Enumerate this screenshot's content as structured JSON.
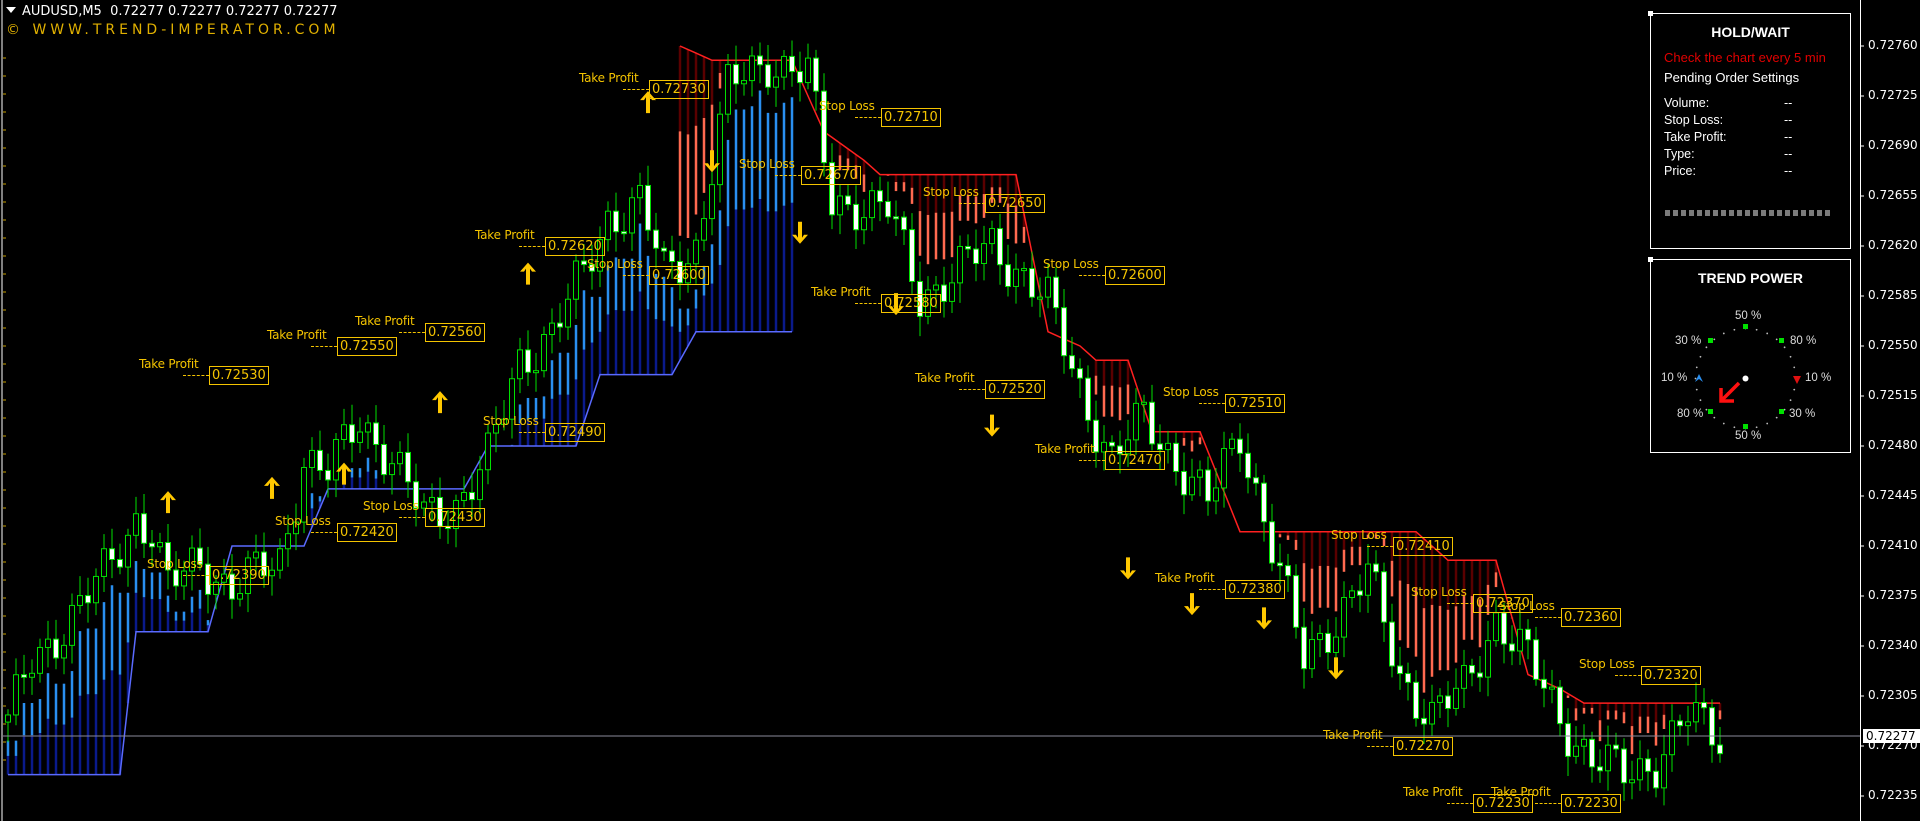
{
  "header": {
    "symbol": "AUDUSD,M5",
    "ohlc": "0.72277 0.72277 0.72277 0.72277",
    "brand": "© WWW.TREND-IMPERATOR.COM"
  },
  "colors": {
    "bull_candle": "#00e000",
    "candle_fill": "#ffffff",
    "up_band_light": "#2a8ff0",
    "up_band_dark": "#0a1a8a",
    "up_stop_line": "#5a6aff",
    "down_band_light": "#ff6a50",
    "down_band_dark": "#5a0000",
    "down_stop_line": "#ff2020",
    "label": "#f4c400",
    "arrow": "#ffc800",
    "price_line": "#8a8a9a"
  },
  "hold_panel": {
    "title": "HOLD/WAIT",
    "warning": "Check the chart every 5 min",
    "subtitle": "Pending Order Settings",
    "rows": [
      {
        "label": "Volume:",
        "value": "--"
      },
      {
        "label": "Stop Loss:",
        "value": "--"
      },
      {
        "label": "Take Profit:",
        "value": "--"
      },
      {
        "label": "Type:",
        "value": "--"
      },
      {
        "label": "Price:",
        "value": "--"
      }
    ]
  },
  "trend_power": {
    "title": "TREND POWER",
    "labels": {
      "top": "50 %",
      "top_left": "30 %",
      "top_right": "80 %",
      "left": "10 %",
      "right": "10 %",
      "bottom_left": "80 %",
      "bottom_right": "30 %",
      "bottom": "50 %"
    },
    "direction": "down-left"
  },
  "chart_data": {
    "type": "candlestick",
    "title": "AUDUSD,M5",
    "xlabel": "",
    "ylabel": "",
    "ylim": [
      0.72216,
      0.72783
    ],
    "y_ticks": [
      "0.72760",
      "0.72725",
      "0.72690",
      "0.72655",
      "0.72620",
      "0.72585",
      "0.72550",
      "0.72515",
      "0.72480",
      "0.72445",
      "0.72410",
      "0.72375",
      "0.72340",
      "0.72305",
      "0.72270",
      "0.72235"
    ],
    "current_price": "0.72277",
    "candle_count": 215,
    "close_waypoints": [
      [
        0,
        0.72285
      ],
      [
        3,
        0.7233
      ],
      [
        8,
        0.7236
      ],
      [
        12,
        0.7239
      ],
      [
        16,
        0.7243
      ],
      [
        18,
        0.7242
      ],
      [
        20,
        0.7238
      ],
      [
        24,
        0.724
      ],
      [
        28,
        0.7238
      ],
      [
        34,
        0.724
      ],
      [
        37,
        0.7247
      ],
      [
        40,
        0.7246
      ],
      [
        44,
        0.725
      ],
      [
        48,
        0.7247
      ],
      [
        52,
        0.7243
      ],
      [
        56,
        0.7244
      ],
      [
        60,
        0.7247
      ],
      [
        64,
        0.7254
      ],
      [
        68,
        0.7256
      ],
      [
        72,
        0.726
      ],
      [
        75,
        0.7264
      ],
      [
        79,
        0.7265
      ],
      [
        82,
        0.726
      ],
      [
        86,
        0.7262
      ],
      [
        90,
        0.7273
      ],
      [
        95,
        0.7275
      ],
      [
        100,
        0.7274
      ],
      [
        103,
        0.7265
      ],
      [
        106,
        0.7265
      ],
      [
        110,
        0.72645
      ],
      [
        114,
        0.72585
      ],
      [
        118,
        0.726
      ],
      [
        123,
        0.7262
      ],
      [
        127,
        0.726
      ],
      [
        130,
        0.7258
      ],
      [
        134,
        0.7252
      ],
      [
        138,
        0.7247
      ],
      [
        142,
        0.725
      ],
      [
        146,
        0.7247
      ],
      [
        150,
        0.7244
      ],
      [
        154,
        0.7249
      ],
      [
        158,
        0.7241
      ],
      [
        162,
        0.7233
      ],
      [
        166,
        0.7236
      ],
      [
        170,
        0.7239
      ],
      [
        174,
        0.7232
      ],
      [
        178,
        0.7229
      ],
      [
        182,
        0.7231
      ],
      [
        186,
        0.7236
      ],
      [
        190,
        0.7233
      ],
      [
        194,
        0.7229
      ],
      [
        198,
        0.7226
      ],
      [
        202,
        0.7225
      ],
      [
        206,
        0.7226
      ],
      [
        210,
        0.7229
      ],
      [
        214,
        0.72277
      ]
    ],
    "up_trend": {
      "range": [
        0,
        98
      ],
      "stop_steps": [
        [
          0,
          0.7225
        ],
        [
          14,
          0.7225
        ],
        [
          16,
          0.7235
        ],
        [
          25,
          0.7235
        ],
        [
          28,
          0.7241
        ],
        [
          37,
          0.7241
        ],
        [
          40,
          0.7245
        ],
        [
          57,
          0.7245
        ],
        [
          60,
          0.7248
        ],
        [
          71,
          0.7248
        ],
        [
          74,
          0.7253
        ],
        [
          83,
          0.7253
        ],
        [
          86,
          0.7256
        ],
        [
          98,
          0.7256
        ]
      ]
    },
    "down_trend": {
      "range": [
        84,
        214
      ],
      "stop_steps": [
        [
          84,
          0.7276
        ],
        [
          88,
          0.7275
        ],
        [
          98,
          0.7275
        ],
        [
          102,
          0.727
        ],
        [
          107,
          0.7268
        ],
        [
          109,
          0.7267
        ],
        [
          126,
          0.7267
        ],
        [
          130,
          0.7256
        ],
        [
          134,
          0.7255
        ],
        [
          136,
          0.7254
        ],
        [
          140,
          0.7254
        ],
        [
          143,
          0.7249
        ],
        [
          149,
          0.7249
        ],
        [
          154,
          0.7242
        ],
        [
          176,
          0.7242
        ],
        [
          180,
          0.724
        ],
        [
          186,
          0.724
        ],
        [
          190,
          0.7232
        ],
        [
          194,
          0.7231
        ],
        [
          197,
          0.723
        ],
        [
          214,
          0.723
        ]
      ]
    },
    "arrows": [
      {
        "dir": "up",
        "i": 20,
        "price": 0.7244
      },
      {
        "dir": "up",
        "i": 33,
        "price": 0.7245
      },
      {
        "dir": "up",
        "i": 42,
        "price": 0.7246
      },
      {
        "dir": "up",
        "i": 54,
        "price": 0.7251
      },
      {
        "dir": "up",
        "i": 65,
        "price": 0.726
      },
      {
        "dir": "up",
        "i": 80,
        "price": 0.7272
      },
      {
        "dir": "down",
        "i": 88,
        "price": 0.7268
      },
      {
        "dir": "down",
        "i": 99,
        "price": 0.7263
      },
      {
        "dir": "down",
        "i": 111,
        "price": 0.7258
      },
      {
        "dir": "down",
        "i": 123,
        "price": 0.72495
      },
      {
        "dir": "down",
        "i": 140,
        "price": 0.72395
      },
      {
        "dir": "down",
        "i": 148,
        "price": 0.7237
      },
      {
        "dir": "down",
        "i": 157,
        "price": 0.7236
      },
      {
        "dir": "down",
        "i": 166,
        "price": 0.72325
      }
    ],
    "annotations": [
      {
        "text": "Take Profit",
        "value": "0.72730",
        "i": 82,
        "price": 0.7273
      },
      {
        "text": "Stop Loss",
        "value": "0.72710",
        "i": 111,
        "price": 0.7271
      },
      {
        "text": "Stop Loss",
        "value": "0.72670",
        "i": 101,
        "price": 0.7267
      },
      {
        "text": "Stop Loss",
        "value": "0.72650",
        "i": 124,
        "price": 0.7265
      },
      {
        "text": "Take Profit",
        "value": "0.72620",
        "i": 69,
        "price": 0.7262
      },
      {
        "text": "Stop Loss",
        "value": "0.72600",
        "i": 82,
        "price": 0.726
      },
      {
        "text": "Stop Loss",
        "value": "0.72600",
        "i": 139,
        "price": 0.726
      },
      {
        "text": "Take Profit",
        "value": "0.72580",
        "i": 111,
        "price": 0.7258
      },
      {
        "text": "Take Profit",
        "value": "0.72560",
        "i": 54,
        "price": 0.7256
      },
      {
        "text": "Take Profit",
        "value": "0.72550",
        "i": 43,
        "price": 0.7255
      },
      {
        "text": "Take Profit",
        "value": "0.72530",
        "i": 27,
        "price": 0.7253
      },
      {
        "text": "Take Profit",
        "value": "0.72520",
        "i": 124,
        "price": 0.7252
      },
      {
        "text": "Stop Loss",
        "value": "0.72510",
        "i": 154,
        "price": 0.7251
      },
      {
        "text": "Stop Loss",
        "value": "0.72490",
        "i": 69,
        "price": 0.7249
      },
      {
        "text": "Take Profit",
        "value": "0.72470",
        "i": 139,
        "price": 0.7247
      },
      {
        "text": "Stop Loss",
        "value": "0.72430",
        "i": 54,
        "price": 0.7243
      },
      {
        "text": "Stop Loss",
        "value": "0.72420",
        "i": 43,
        "price": 0.7242
      },
      {
        "text": "Stop Loss",
        "value": "0.72410",
        "i": 175,
        "price": 0.7241
      },
      {
        "text": "Stop Loss",
        "value": "0.72390",
        "i": 27,
        "price": 0.7239
      },
      {
        "text": "Take Profit",
        "value": "0.72380",
        "i": 154,
        "price": 0.7238
      },
      {
        "text": "Stop Loss",
        "value": "0.72370",
        "i": 185,
        "price": 0.7237
      },
      {
        "text": "Stop Loss",
        "value": "0.72360",
        "i": 196,
        "price": 0.7236
      },
      {
        "text": "Stop Loss",
        "value": "0.72320",
        "i": 206,
        "price": 0.7232
      },
      {
        "text": "Take Profit",
        "value": "0.72270",
        "i": 175,
        "price": 0.7227
      },
      {
        "text": "Take Profit",
        "value": "0.72230",
        "i": 185,
        "price": 0.7223
      },
      {
        "text": "Take Profit",
        "value": "0.72230",
        "i": 196,
        "price": 0.7223
      }
    ]
  }
}
